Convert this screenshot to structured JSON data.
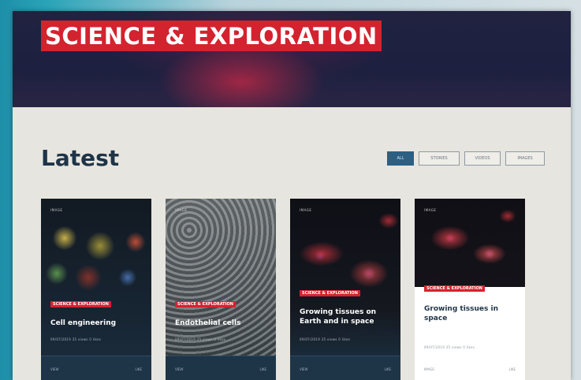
{
  "hero": {
    "title": "SCIENCE & EXPLORATION"
  },
  "section": {
    "heading": "Latest"
  },
  "filters": [
    {
      "label": "ALL",
      "active": true
    },
    {
      "label": "STORIES",
      "active": false
    },
    {
      "label": "VIDEOS",
      "active": false
    },
    {
      "label": "IMAGES",
      "active": false
    }
  ],
  "cards": [
    {
      "kicker": "IMAGE",
      "tag": "SCIENCE & EXPLORATION",
      "title": "Cell engineering",
      "meta": "09/07/2019   35 views   0 likes",
      "footer_left": "VIEW",
      "footer_right": "LIKE"
    },
    {
      "kicker": "IMAGE",
      "tag": "SCIENCE & EXPLORATION",
      "title": "Endothelial cells",
      "meta": "09/07/2019   35 views   0 likes",
      "footer_left": "VIEW",
      "footer_right": "LIKE"
    },
    {
      "kicker": "IMAGE",
      "tag": "SCIENCE & EXPLORATION",
      "title": "Growing tissues on Earth and in space",
      "meta": "09/07/2019   35 views   0 likes",
      "footer_left": "VIEW",
      "footer_right": "LIKE"
    },
    {
      "kicker": "IMAGE",
      "tag": "SCIENCE & EXPLORATION",
      "title": "Growing tissues in space",
      "meta": "09/07/2019   35 views   0 likes",
      "footer_left": "IMAGE",
      "footer_right": "LIKE"
    }
  ],
  "colors": {
    "accent_red": "#d3232f",
    "navy": "#1e3447",
    "active_filter": "#2c5f82"
  }
}
